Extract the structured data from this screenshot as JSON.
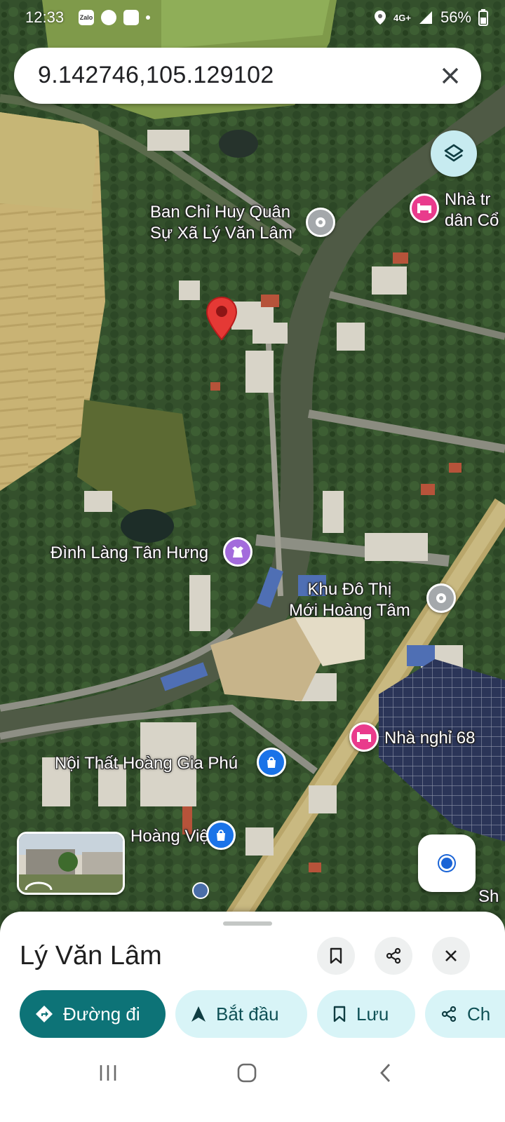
{
  "status_bar": {
    "time": "12:33",
    "app_icons": [
      "Zalo",
      "messenger-icon",
      "gallery-icon"
    ],
    "network": "4G+",
    "battery": "56%"
  },
  "search": {
    "query": "9.142746,105.129102"
  },
  "map": {
    "labels": [
      {
        "text": "Ban Chỉ Huy Quân\nSự Xã Lý Văn Lâm",
        "icon": "place-pin-icon"
      },
      {
        "text": "Nhà tr\ndân Cổ",
        "icon": "lodging-icon"
      },
      {
        "text": "Đình Làng Tân Hưng",
        "icon": "landmark-icon"
      },
      {
        "text": "Khu Đô Thị\nMới Hoàng Tâm",
        "icon": "place-pin-icon"
      },
      {
        "text": "Nhà nghỉ 68",
        "icon": "lodging-icon"
      },
      {
        "text": "Nội Thất Hoàng Gia Phú",
        "icon": "shopping-icon"
      },
      {
        "text": "Hoàng Việt",
        "icon": "shopping-icon"
      },
      {
        "text": "Sh",
        "icon": ""
      }
    ],
    "accent_colors": {
      "lodging": "#e93b8c",
      "landmark": "#a36bdc",
      "shopping": "#1a73e8",
      "pin": "#a4a8ab",
      "marker": "#e53935"
    }
  },
  "sheet": {
    "title": "Lý Văn Lâm",
    "actions": [
      {
        "label": "Đường đi",
        "icon": "directions-icon",
        "primary": true
      },
      {
        "label": "Bắt đầu",
        "icon": "navigation-arrow-icon",
        "primary": false
      },
      {
        "label": "Lưu",
        "icon": "bookmark-icon",
        "primary": false
      },
      {
        "label": "Ch",
        "icon": "share-icon",
        "primary": false
      }
    ]
  },
  "colors": {
    "primary_chip": "#0d7377",
    "secondary_chip": "#d8f4f7",
    "layers_button": "#c7ebf0",
    "my_location": "#1a64d6"
  }
}
